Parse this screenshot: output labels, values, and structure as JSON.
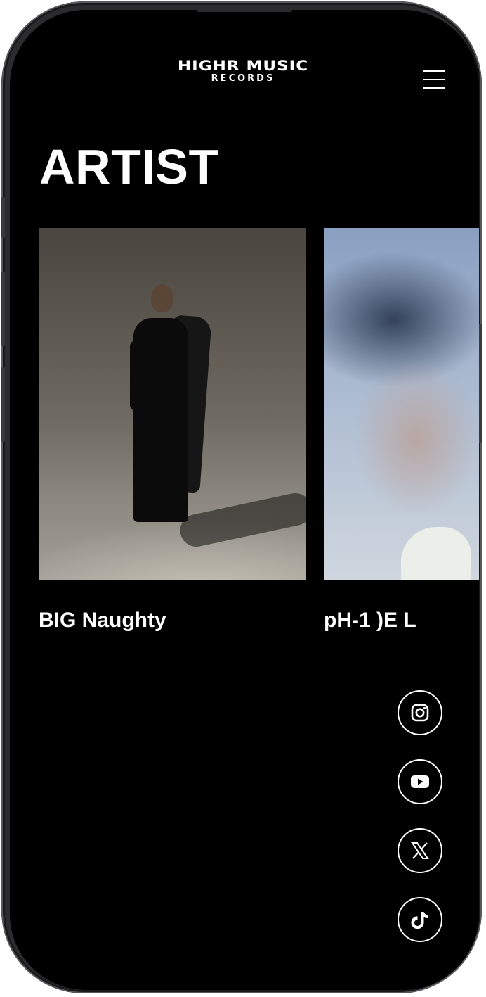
{
  "header": {
    "logo_line1": "HIGHR MUSIC",
    "logo_line2": "RECORDS",
    "menu_icon": "hamburger-menu-icon"
  },
  "page": {
    "title": "ARTIST"
  },
  "artists": [
    {
      "name": "BIG Naughty"
    },
    {
      "name": "pH-1  )E L"
    }
  ],
  "social": [
    {
      "icon": "instagram-icon"
    },
    {
      "icon": "youtube-icon"
    },
    {
      "icon": "x-twitter-icon"
    },
    {
      "icon": "tiktok-icon"
    }
  ],
  "colors": {
    "background": "#000000",
    "text": "#ffffff"
  }
}
